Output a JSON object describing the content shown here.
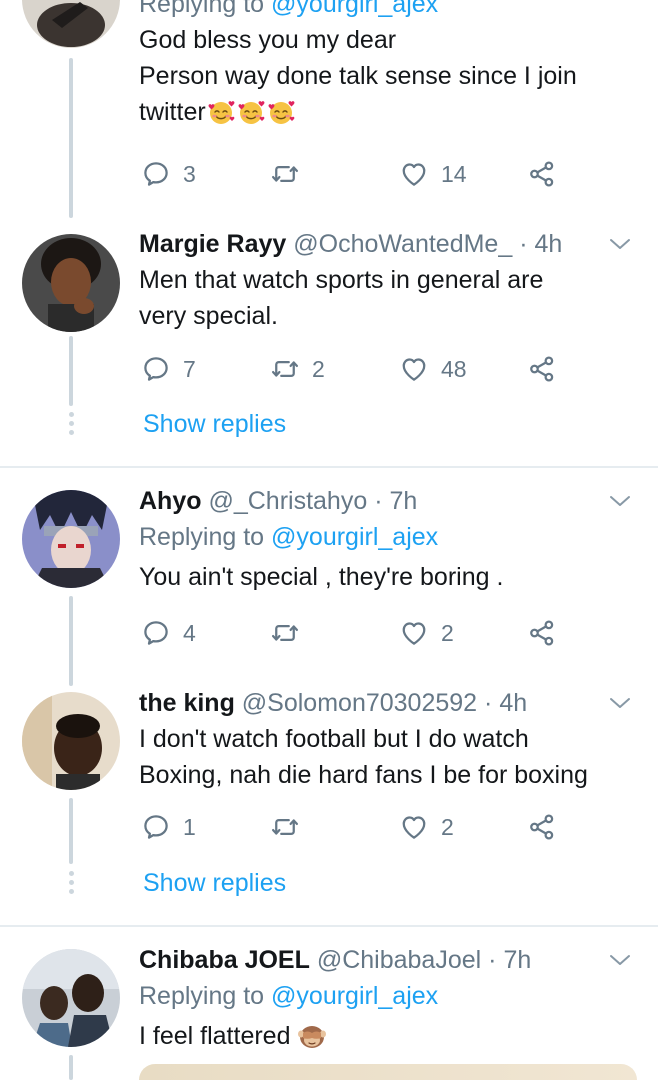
{
  "colors": {
    "accent": "#1da1f2",
    "muted": "#657786",
    "text": "#14171a",
    "line": "#ccd6dd"
  },
  "tweets": [
    {
      "reply_to_prefix": "Replying to ",
      "reply_to_handle": "@yourgirl_ajex",
      "text_line1": "God bless you my dear",
      "text_line2": "Person way done talk sense since I join",
      "text_line3": "twitter",
      "emoji": "smiling-face-with-hearts",
      "replies": "3",
      "retweets": "",
      "likes": "14"
    },
    {
      "name": "Margie Rayy",
      "handle": "@OchoWantedMe_",
      "dot": "·",
      "time": "4h",
      "text_line1": "Men that watch sports in general are",
      "text_line2": "very special.",
      "replies": "7",
      "retweets": "2",
      "likes": "48",
      "show_replies": "Show replies"
    },
    {
      "name": "Ahyo",
      "handle": "@_Christahyo",
      "dot": "·",
      "time": "7h",
      "reply_to_prefix": "Replying to ",
      "reply_to_handle": "@yourgirl_ajex",
      "text_line1": "You ain't special , they're boring .",
      "replies": "4",
      "retweets": "",
      "likes": "2"
    },
    {
      "name": "the king",
      "handle": "@Solomon70302592",
      "dot": "·",
      "time": "4h",
      "text_line1": "I don't watch football but I do watch",
      "text_line2": "Boxing,  nah die hard fans I be for boxing",
      "replies": "1",
      "retweets": "",
      "likes": "2",
      "show_replies": "Show replies"
    },
    {
      "name": "Chibaba JOEL",
      "handle": "@ChibabaJoel",
      "dot": "·",
      "time": "7h",
      "reply_to_prefix": "Replying to ",
      "reply_to_handle": "@yourgirl_ajex",
      "text_line1": "I feel flattered",
      "emoji": "see-no-evil-monkey"
    }
  ]
}
